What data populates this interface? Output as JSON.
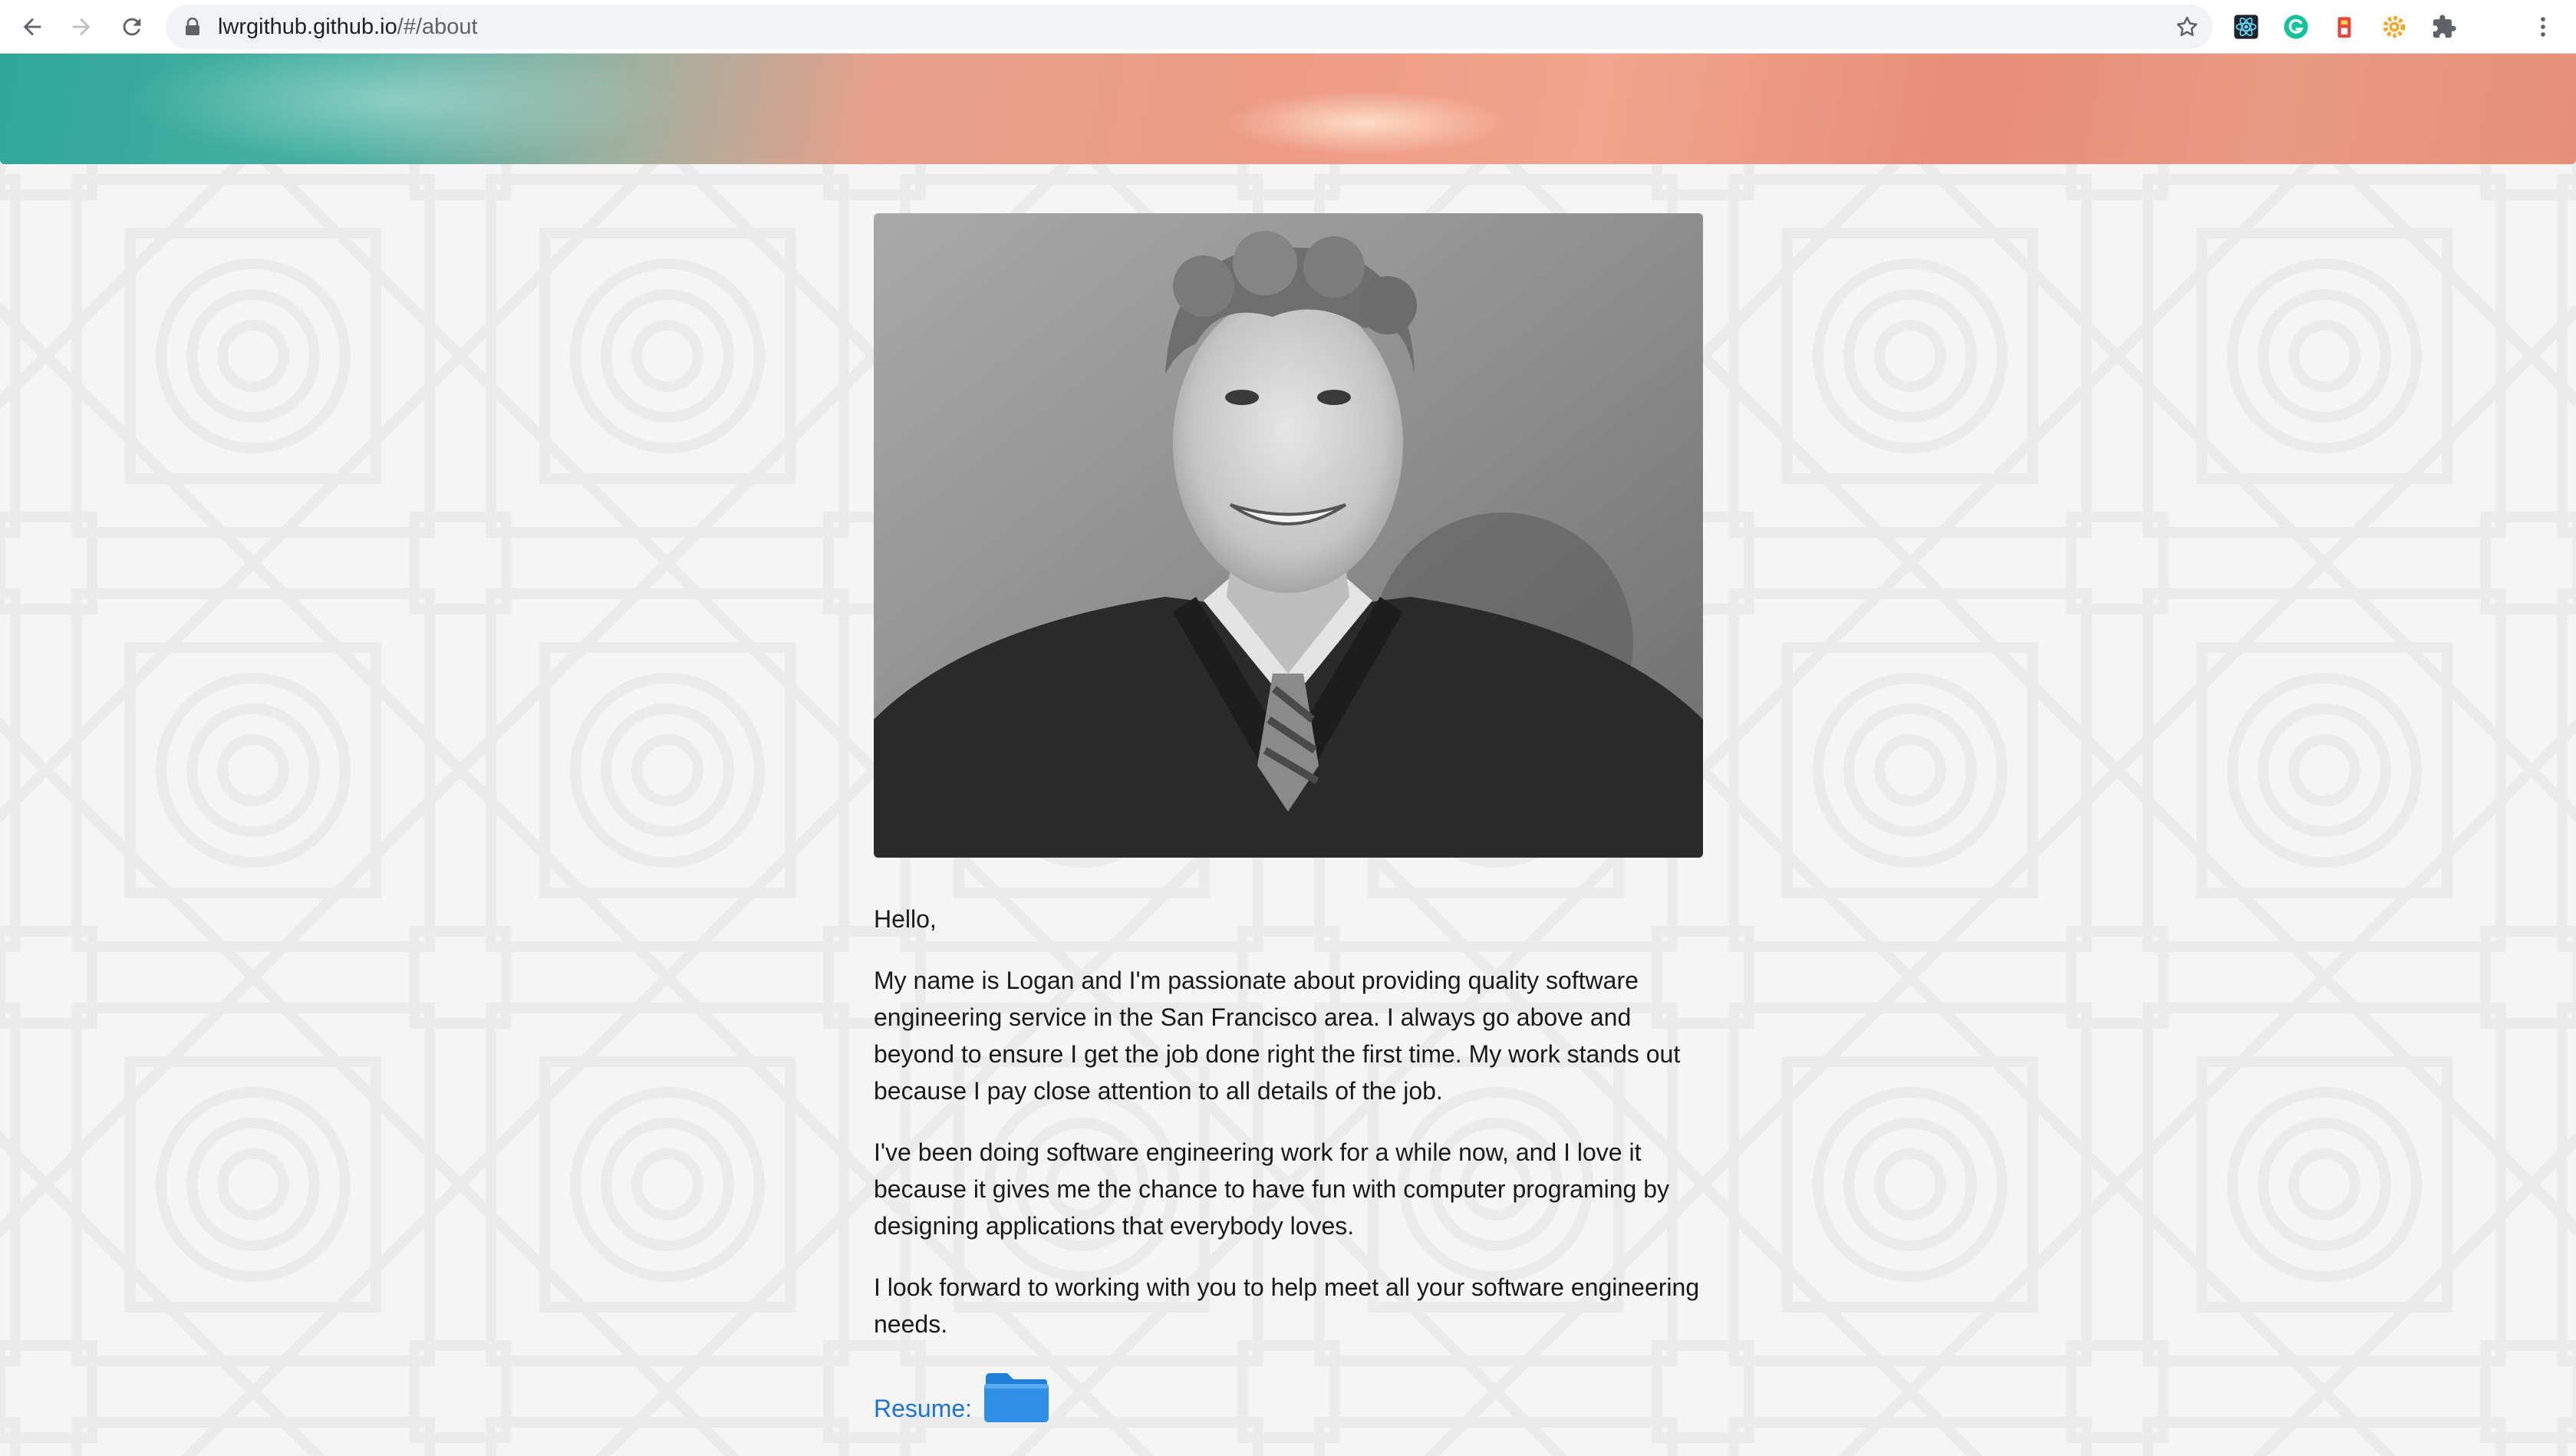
{
  "browser": {
    "url_host": "lwrgithub.github.io",
    "url_path": "/#/about",
    "icons": [
      "back-arrow-icon",
      "forward-arrow-icon",
      "reload-icon",
      "lock-icon",
      "bookmark-star-icon",
      "react-devtools-icon",
      "grammarly-icon",
      "extension-red-icon",
      "extension-gear-icon",
      "extensions-puzzle-icon",
      "menu-kebab-icon"
    ]
  },
  "about": {
    "greeting": "Hello,",
    "paragraphs": [
      "My name is Logan and I'm passionate about providing quality software engineering service in the San Francisco area. I always go above and beyond to ensure I get the job done right the first time. My work stands out because I pay close attention to all details of the job.",
      "I've been doing software engineering work for a while now, and I love it because it gives me the chance to have fun with computer programing by designing applications that everybody loves.",
      "I look forward to working with you to help meet all your software engineering needs."
    ],
    "resume_label": "Resume:"
  },
  "colors": {
    "link": "#1a74d8",
    "text": "#1a1a1a",
    "background": "#f5f5f5",
    "folder": "#2f8fe6"
  }
}
